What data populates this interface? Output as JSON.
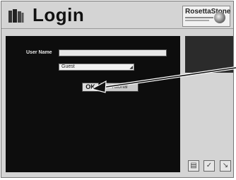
{
  "header": {
    "title": "Login",
    "brand": "RosettaStone",
    "app_icon": "books-icon"
  },
  "login": {
    "username_label": "User Name",
    "username_value": "",
    "password_value": "Guest",
    "ok_label": "OK",
    "tutorial_label": "Tutorial"
  },
  "footer_icons": [
    "settings-icon",
    "help-icon",
    "exit-icon"
  ],
  "annotation": {
    "type": "arrow",
    "points_to": "ok-button"
  }
}
